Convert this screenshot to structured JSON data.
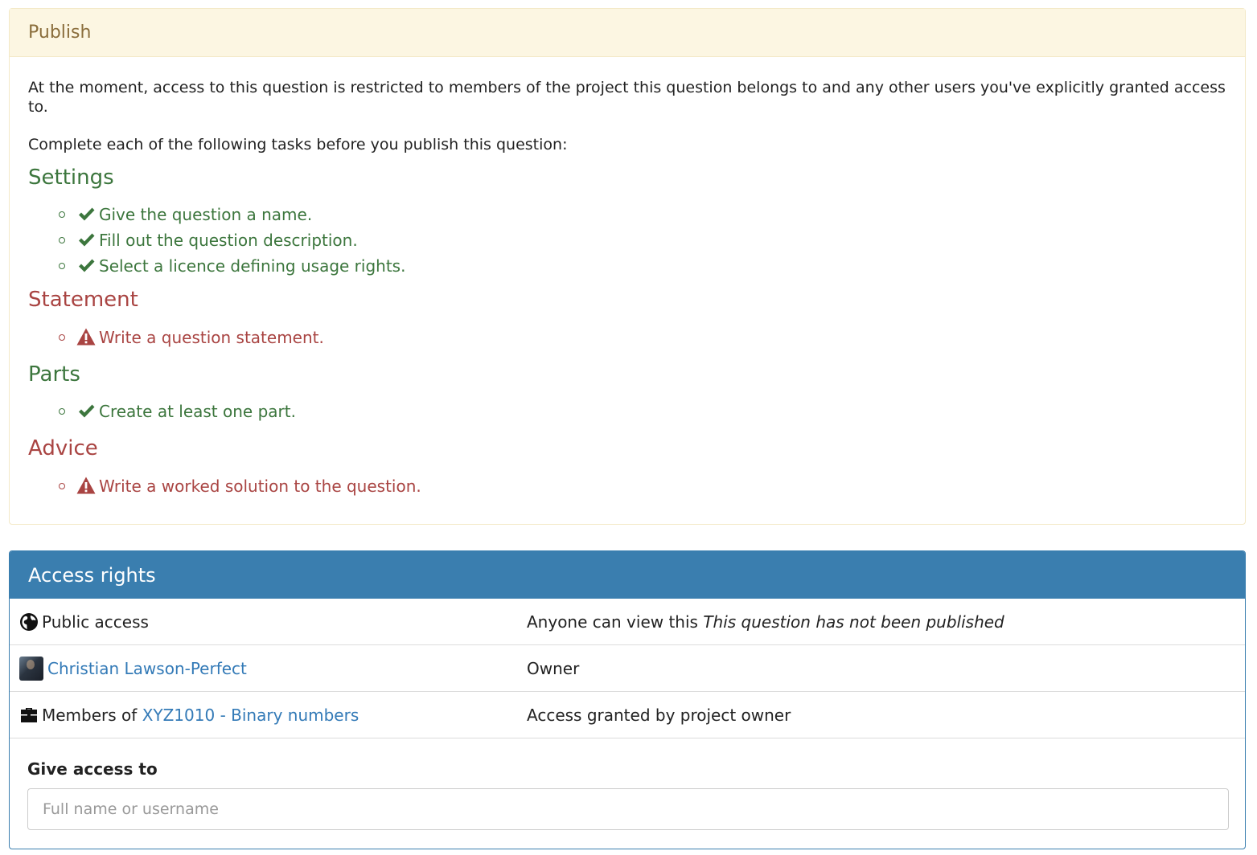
{
  "publish": {
    "title": "Publish",
    "intro": "At the moment, access to this question is restricted to members of the project this question belongs to and any other users you've explicitly granted access to.",
    "tasks_intro": "Complete each of the following tasks before you publish this question:",
    "sections": [
      {
        "title": "Settings",
        "status": "ok",
        "items": [
          {
            "text": "Give the question a name.",
            "icon": "check-icon"
          },
          {
            "text": "Fill out the question description.",
            "icon": "check-icon"
          },
          {
            "text": "Select a licence defining usage rights.",
            "icon": "check-icon"
          }
        ]
      },
      {
        "title": "Statement",
        "status": "warning",
        "items": [
          {
            "text": "Write a question statement.",
            "icon": "warning-icon"
          }
        ]
      },
      {
        "title": "Parts",
        "status": "ok",
        "items": [
          {
            "text": "Create at least one part.",
            "icon": "check-icon"
          }
        ]
      },
      {
        "title": "Advice",
        "status": "warning",
        "items": [
          {
            "text": "Write a worked solution to the question.",
            "icon": "warning-icon"
          }
        ]
      }
    ],
    "colors": {
      "ok": "#3c763d",
      "warning": "#a94442",
      "header_bg": "#fcf6e2"
    }
  },
  "access": {
    "title": "Access rights",
    "rows": [
      {
        "icon": "globe-icon",
        "who": "Public access",
        "desc_prefix": "Anyone can view this",
        "desc_italic": "This question has not been published"
      },
      {
        "icon": "avatar",
        "who_link": "Christian Lawson-Perfect",
        "desc": "Owner"
      },
      {
        "icon": "briefcase-icon",
        "who_prefix": "Members of",
        "who_link": "XYZ1010 - Binary numbers",
        "desc": "Access granted by project owner"
      }
    ],
    "give_access": {
      "label": "Give access to",
      "placeholder": "Full name or username"
    },
    "colors": {
      "header_bg": "#3a7eaf",
      "link": "#337ab7"
    }
  }
}
